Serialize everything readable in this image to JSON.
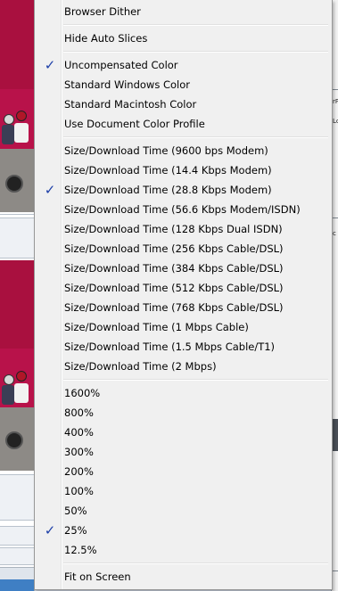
{
  "menu": {
    "groups": [
      [
        {
          "label": "Browser Dither",
          "checked": false
        }
      ],
      [
        {
          "label": "Hide Auto Slices",
          "checked": false
        }
      ],
      [
        {
          "label": "Uncompensated Color",
          "checked": true
        },
        {
          "label": "Standard Windows Color",
          "checked": false
        },
        {
          "label": "Standard Macintosh Color",
          "checked": false
        },
        {
          "label": "Use Document Color Profile",
          "checked": false
        }
      ],
      [
        {
          "label": "Size/Download Time (9600 bps Modem)",
          "checked": false
        },
        {
          "label": "Size/Download Time (14.4 Kbps Modem)",
          "checked": false
        },
        {
          "label": "Size/Download Time (28.8 Kbps Modem)",
          "checked": true
        },
        {
          "label": "Size/Download Time (56.6 Kbps Modem/ISDN)",
          "checked": false
        },
        {
          "label": "Size/Download Time (128 Kbps Dual ISDN)",
          "checked": false
        },
        {
          "label": "Size/Download Time (256 Kbps Cable/DSL)",
          "checked": false
        },
        {
          "label": "Size/Download Time (384 Kbps Cable/DSL)",
          "checked": false
        },
        {
          "label": "Size/Download Time (512 Kbps Cable/DSL)",
          "checked": false
        },
        {
          "label": "Size/Download Time (768 Kbps Cable/DSL)",
          "checked": false
        },
        {
          "label": "Size/Download Time (1 Mbps Cable)",
          "checked": false
        },
        {
          "label": "Size/Download Time (1.5 Mbps Cable/T1)",
          "checked": false
        },
        {
          "label": "Size/Download Time (2 Mbps)",
          "checked": false
        }
      ],
      [
        {
          "label": "1600%",
          "checked": false
        },
        {
          "label": "800%",
          "checked": false
        },
        {
          "label": "400%",
          "checked": false
        },
        {
          "label": "300%",
          "checked": false
        },
        {
          "label": "200%",
          "checked": false
        },
        {
          "label": "100%",
          "checked": false
        },
        {
          "label": "50%",
          "checked": false
        },
        {
          "label": "25%",
          "checked": true
        },
        {
          "label": "12.5%",
          "checked": false
        }
      ],
      [
        {
          "label": "Fit on Screen",
          "checked": false
        }
      ]
    ],
    "check_glyph": "✓",
    "check_color": "#1d3fa8"
  },
  "background": {
    "right_fragments": [
      "rP",
      "Lc",
      "c"
    ]
  }
}
